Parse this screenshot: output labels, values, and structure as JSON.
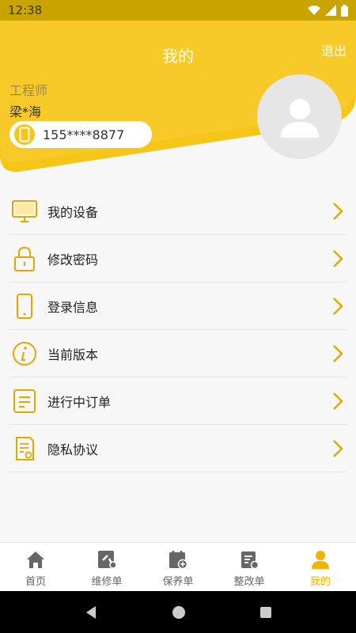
{
  "status_bar": {
    "time": "12:38"
  },
  "header": {
    "title": "我的",
    "logout_label": "退出",
    "role": "工程师",
    "user_name": "梁*海",
    "phone": "155****8877"
  },
  "colors": {
    "accent": "#f5c518",
    "accent_dark": "#c9a400",
    "icon": "#e0a800",
    "text": "#222222"
  },
  "menu": {
    "items": [
      {
        "label": "我的设备",
        "icon": "monitor-icon"
      },
      {
        "label": "修改密码",
        "icon": "lock-icon"
      },
      {
        "label": "登录信息",
        "icon": "phone-icon"
      },
      {
        "label": "当前版本",
        "icon": "info-icon"
      },
      {
        "label": "进行中订单",
        "icon": "order-icon"
      },
      {
        "label": "隐私协议",
        "icon": "document-icon"
      }
    ]
  },
  "bottom_nav": {
    "items": [
      {
        "label": "首页",
        "icon": "home-icon"
      },
      {
        "label": "维修单",
        "icon": "repair-icon"
      },
      {
        "label": "保养单",
        "icon": "maintenance-icon"
      },
      {
        "label": "整改单",
        "icon": "rectify-icon"
      },
      {
        "label": "我的",
        "icon": "user-icon",
        "active": true
      }
    ]
  }
}
